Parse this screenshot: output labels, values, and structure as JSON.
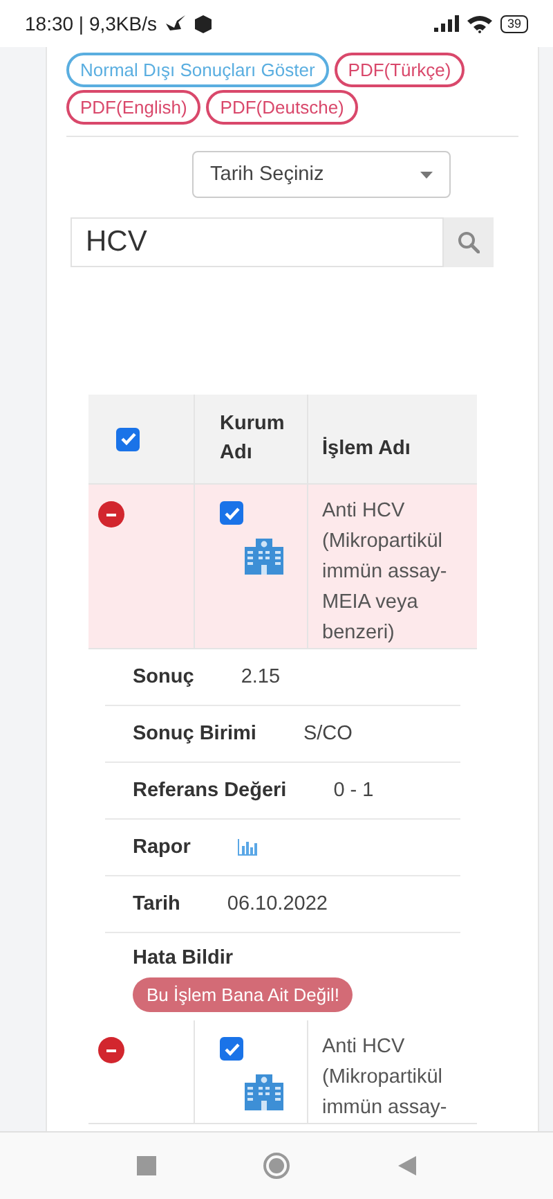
{
  "status_bar": {
    "time": "18:30 | 9,3KB/s",
    "battery": "39"
  },
  "filter_buttons": [
    {
      "label": "Normal Dışı Sonuçları Göster",
      "kind": "outline-blue"
    },
    {
      "label": "PDF(Türkçe)",
      "kind": "outline-red"
    },
    {
      "label": "PDF(English)",
      "kind": "outline-red"
    },
    {
      "label": "PDF(Deutsche)",
      "kind": "outline-red"
    }
  ],
  "date_select": {
    "value": "Tarih Seçiniz"
  },
  "search": {
    "value": "HCV"
  },
  "table": {
    "header_checked": true,
    "columns": [
      "Kurum Adı",
      "İşlem Adı"
    ],
    "rows": [
      {
        "expanded": true,
        "checked": true,
        "name": "Anti HCV (Mikropartikül immün assay-MEIA veya benzeri)",
        "details": [
          {
            "label": "Sonuç",
            "value": "2.15",
            "kind": "text"
          },
          {
            "label": "Sonuç Birimi",
            "value": "S/CO",
            "kind": "text"
          },
          {
            "label": "Referans Değeri",
            "value": "0 - 1",
            "kind": "text"
          },
          {
            "label": "Rapor",
            "kind": "chart-link"
          },
          {
            "label": "Tarih",
            "value": "06.10.2022",
            "kind": "text"
          }
        ],
        "report_error": {
          "label": "Hata Bildir",
          "button": "Bu İşlem Bana Ait Değil!"
        }
      },
      {
        "expanded": true,
        "checked": true,
        "name": "Anti HCV (Mikropartikül immün assay-"
      }
    ]
  }
}
